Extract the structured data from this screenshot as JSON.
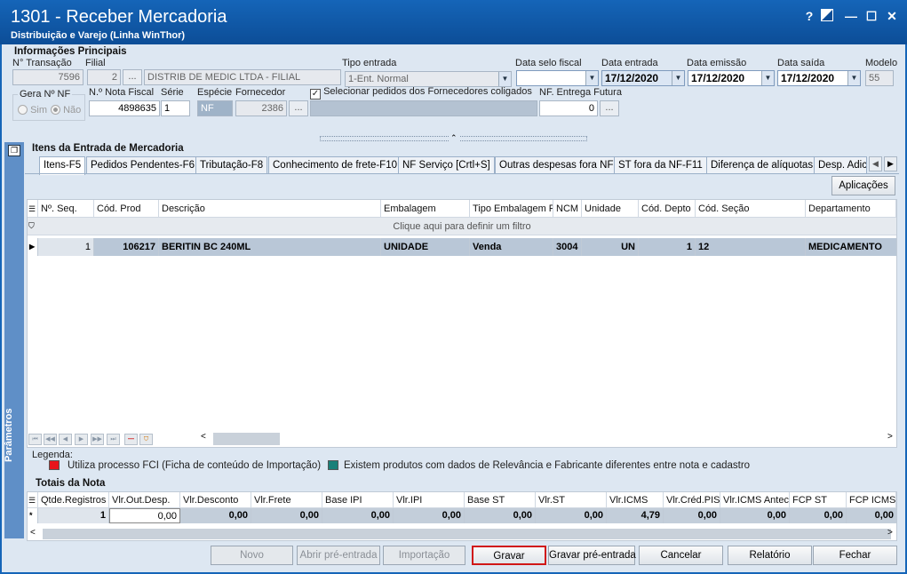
{
  "window": {
    "title": "1301 - Receber Mercadoria",
    "subtitle": "Distribuição e Varejo (Linha WinThor)",
    "help": "?",
    "minimize": "—",
    "maximize": "☐",
    "close": "✕"
  },
  "info": {
    "group_title": "Informações Principais",
    "transacao_label": "N° Transação",
    "transacao": "7596",
    "filial_label": "Filial",
    "filial": "2",
    "filial_nome": "DISTRIB DE MEDIC LTDA - FILIAL",
    "tipo_entrada_label": "Tipo entrada",
    "tipo_entrada": "1-Ent. Normal",
    "data_selo_label": "Data selo fiscal",
    "data_selo": "",
    "data_entrada_label": "Data entrada",
    "data_entrada": "17/12/2020",
    "data_emissao_label": "Data emissão",
    "data_emissao": "17/12/2020",
    "data_saida_label": "Data saída",
    "data_saida": "17/12/2020",
    "modelo_label": "Modelo",
    "modelo": "55",
    "gera_nf_label": "Gera Nº NF",
    "sim": "Sim",
    "nao": "Não",
    "nota_fiscal_label": "N.º Nota Fiscal",
    "nota_fiscal": "4898635",
    "serie_label": "Série",
    "serie": "1",
    "especie_label": "Espécie",
    "especie": "NF",
    "fornecedor_label": "Fornecedor",
    "fornecedor": "2386",
    "coligados_label": "Selecionar pedidos dos Fornecedores coligados",
    "nf_futura_label": "NF. Entrega Futura",
    "nf_futura": "0",
    "ellipsis": "..."
  },
  "items": {
    "group_title": "Itens da Entrada de Mercadoria",
    "tabs": [
      "Itens-F5",
      "Pedidos Pendentes-F6",
      "Tributação-F8",
      "Conhecimento de frete-F10",
      "NF Serviço [Crtl+S]",
      "Outras despesas fora NF",
      "ST fora da NF-F11",
      "Diferença de alíquotas",
      "Desp. Adici"
    ],
    "aplicacoes": "Aplicações",
    "columns": [
      "Nº. Seq.",
      "Cód. Prod",
      "Descrição",
      "Embalagem",
      "Tipo Embalagem Pe",
      "NCM",
      "Unidade",
      "Cód. Depto",
      "Cód. Seção",
      "Departamento"
    ],
    "filter_text": "Clique aqui para definir um filtro",
    "row": [
      "1",
      "106217",
      "BERITIN BC 240ML",
      "UNIDADE",
      "Venda",
      "3004",
      "UN",
      "1",
      "12",
      "MEDICAMENTO"
    ]
  },
  "legend": {
    "title": "Legenda:",
    "items": [
      {
        "color": "#e8141b",
        "text": "Utiliza processo FCI (Ficha de conteúdo de Importação)"
      },
      {
        "color": "#1a8079",
        "text": "Existem produtos com dados de Relevância e Fabricante diferentes entre nota e cadastro"
      }
    ]
  },
  "totais": {
    "title": "Totais da Nota",
    "columns": [
      "Qtde.Registros",
      "Vlr.Out.Desp.",
      "Vlr.Desconto",
      "Vlr.Frete",
      "Base IPI",
      "Vlr.IPI",
      "Base ST",
      "Vlr.ST",
      "Vlr.ICMS",
      "Vlr.Créd.PIS",
      "Vlr.ICMS Anteci",
      "FCP ST",
      "FCP ICMS"
    ],
    "values": [
      "1",
      "0,00",
      "0,00",
      "0,00",
      "0,00",
      "0,00",
      "0,00",
      "0,00",
      "4,79",
      "0,00",
      "0,00",
      "0,00",
      "0,00"
    ]
  },
  "sidebar_label": "Parâmetros",
  "buttons": {
    "novo": "Novo",
    "abrir": "Abrir pré-entrada",
    "importacao": "Importação",
    "gravar": "Gravar",
    "gravar_pre": "Gravar pré-entrada",
    "cancelar": "Cancelar",
    "relatorio": "Relatório",
    "fechar": "Fechar"
  }
}
